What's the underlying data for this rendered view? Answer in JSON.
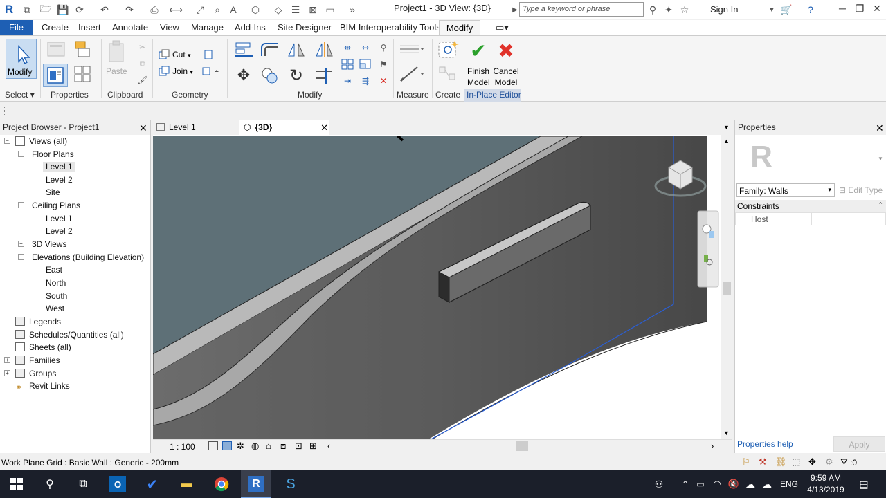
{
  "titlebar": {
    "app_logo": "R",
    "title": "Project1 - 3D View: {3D}",
    "search_placeholder": "Type a keyword or phrase",
    "sign_in": "Sign In"
  },
  "menu": {
    "tabs": [
      "File",
      "Create",
      "Insert",
      "Annotate",
      "View",
      "Manage",
      "Add-Ins",
      "Site Designer",
      "BIM Interoperability Tools",
      "Modify"
    ],
    "active": "Modify"
  },
  "ribbon": {
    "select": {
      "modify_label": "Modify",
      "panel": "Select"
    },
    "properties": {
      "panel": "Properties"
    },
    "clipboard": {
      "paste": "Paste",
      "panel": "Clipboard"
    },
    "geometry": {
      "cut": "Cut",
      "join": "Join",
      "panel": "Geometry"
    },
    "modify": {
      "panel": "Modify"
    },
    "measure": {
      "panel": "Measure"
    },
    "create": {
      "panel": "Create"
    },
    "inplace": {
      "finish_line1": "Finish",
      "finish_line2": "Model",
      "cancel_line1": "Cancel",
      "cancel_line2": "Model",
      "panel": "In-Place Editor"
    }
  },
  "project_browser": {
    "title": "Project Browser - Project1",
    "nodes": {
      "views_all": "Views (all)",
      "floor_plans": "Floor Plans",
      "fp_level1": "Level 1",
      "fp_level2": "Level 2",
      "fp_site": "Site",
      "ceiling_plans": "Ceiling Plans",
      "cp_level1": "Level 1",
      "cp_level2": "Level 2",
      "views_3d": "3D Views",
      "elevations": "Elevations (Building Elevation)",
      "el_east": "East",
      "el_north": "North",
      "el_south": "South",
      "el_west": "West",
      "legends": "Legends",
      "schedules": "Schedules/Quantities (all)",
      "sheets": "Sheets (all)",
      "families": "Families",
      "groups": "Groups",
      "revit_links": "Revit Links"
    }
  },
  "view_tabs": {
    "tab1": "Level 1",
    "tab2": "{3D}"
  },
  "view_bar": {
    "scale": "1 : 100"
  },
  "properties": {
    "title": "Properties",
    "family": "Family: Walls",
    "edit_type": "Edit Type",
    "constraints": "Constraints",
    "host": "Host",
    "help": "Properties help",
    "apply": "Apply"
  },
  "status": {
    "text": "Work Plane Grid : Basic Wall : Generic - 200mm",
    "filter_count": ":0"
  },
  "taskbar": {
    "lang": "ENG",
    "time": "9:59 AM",
    "date": "4/13/2019"
  },
  "colors": {
    "file_blue": "#1e5fb4",
    "sky": "#5e7077",
    "wall_dark": "#5b5b5b",
    "wall_light": "#b8b8b8",
    "selection_blue": "#2a5fd6",
    "taskbar": "#1b1f2a"
  }
}
